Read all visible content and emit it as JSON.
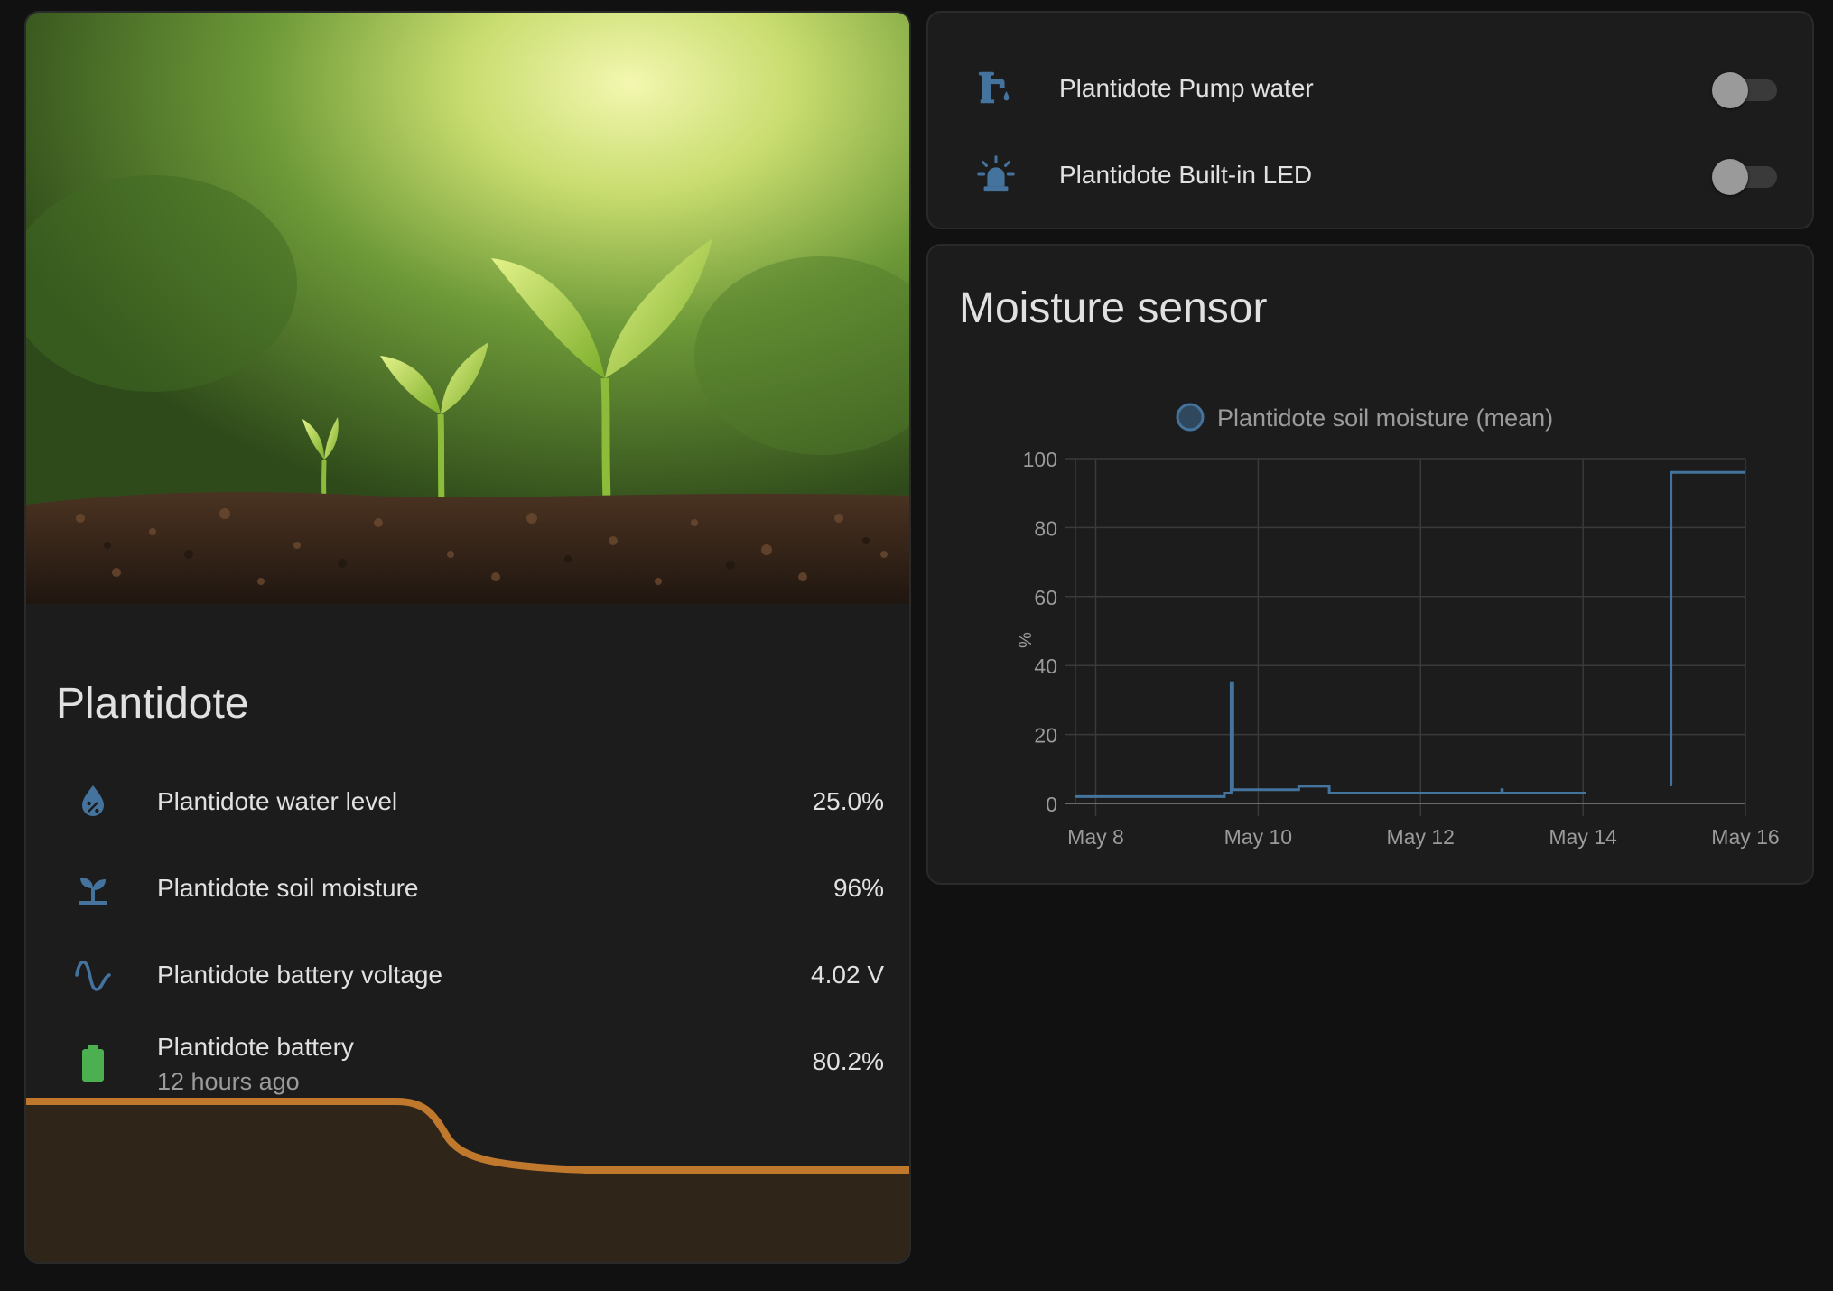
{
  "plant_card": {
    "title": "Plantidote",
    "entities": [
      {
        "name": "Plantidote water level",
        "value": "25.0%",
        "icon": "water-percent-icon",
        "secondary": ""
      },
      {
        "name": "Plantidote soil moisture",
        "value": "96%",
        "icon": "sprout-icon",
        "secondary": ""
      },
      {
        "name": "Plantidote battery voltage",
        "value": "4.02 V",
        "icon": "sine-wave-icon",
        "secondary": ""
      },
      {
        "name": "Plantidote battery",
        "value": "80.2%",
        "icon": "battery-icon",
        "secondary": "12 hours ago"
      }
    ],
    "image": "seedlings-in-soil-photo",
    "graph_color": "#c0782c"
  },
  "switches": [
    {
      "name": "Plantidote Pump water",
      "icon": "water-pump-icon",
      "state": "off"
    },
    {
      "name": "Plantidote Built-in LED",
      "icon": "alarm-light-icon",
      "state": "off"
    }
  ],
  "moisture_card": {
    "title": "Moisture sensor"
  },
  "colors": {
    "accent": "#44739e",
    "battery_green": "#4caf50",
    "background": "#111111",
    "card": "#1c1c1c"
  },
  "chart_data": {
    "type": "line",
    "title": "Moisture sensor",
    "legend": [
      "Plantidote soil moisture (mean)"
    ],
    "legend_position": "top",
    "ylabel": "%",
    "ylim": [
      0,
      100
    ],
    "yticks": [
      "0",
      "20",
      "40",
      "60",
      "80",
      "100"
    ],
    "xlim": [
      "2024-05-07T18:00",
      "2024-05-16T00:00"
    ],
    "xticks": [
      "May 8",
      "May 10",
      "May 12",
      "May 14",
      "May 16"
    ],
    "grid": true,
    "series": [
      {
        "name": "Plantidote soil moisture (mean)",
        "segments": [
          [
            [
              "2024-05-07T18:00",
              2
            ],
            [
              "2024-05-09T14:00",
              2
            ],
            [
              "2024-05-09T14:00",
              3
            ],
            [
              "2024-05-09T16:00",
              3
            ],
            [
              "2024-05-09T16:00",
              35
            ],
            [
              "2024-05-09T16:30",
              35
            ],
            [
              "2024-05-09T16:30",
              4
            ],
            [
              "2024-05-10T12:00",
              4
            ],
            [
              "2024-05-10T12:00",
              5
            ],
            [
              "2024-05-10T21:00",
              5
            ],
            [
              "2024-05-10T21:00",
              3
            ],
            [
              "2024-05-13T00:00",
              3
            ],
            [
              "2024-05-13T00:00",
              4
            ],
            [
              "2024-05-13T00:10",
              4
            ],
            [
              "2024-05-13T00:10",
              3
            ],
            [
              "2024-05-14T01:00",
              3
            ]
          ],
          [
            [
              "2024-05-15T02:00",
              5
            ],
            [
              "2024-05-15T02:00",
              96
            ],
            [
              "2024-05-16T00:00",
              96
            ]
          ]
        ]
      }
    ]
  }
}
